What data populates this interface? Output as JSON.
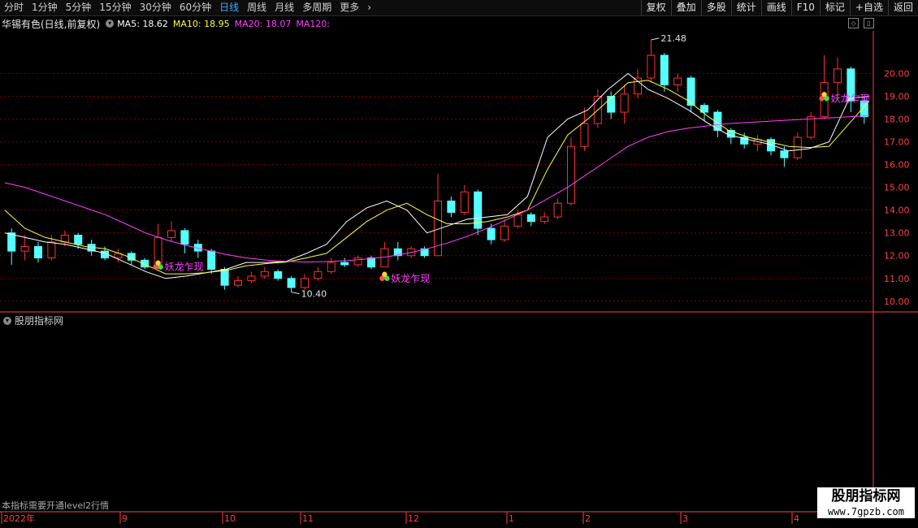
{
  "toolbar": {
    "periods": [
      "分时",
      "1分钟",
      "5分钟",
      "15分钟",
      "30分钟",
      "60分钟",
      "日线",
      "周线",
      "月线",
      "多周期",
      "更多"
    ],
    "active_period": "日线",
    "tools": [
      "复权",
      "叠加",
      "多股",
      "统计",
      "画线",
      "F10",
      "标记",
      "+自选",
      "返回"
    ]
  },
  "chart_header": {
    "title": "华锡有色(日线,前复权)",
    "ma5": "MA5: 18.62",
    "ma10": "MA10: 18.95",
    "ma20": "MA20: 18.07",
    "ma120": "MA120:"
  },
  "colors": {
    "up": "#ff3030",
    "down": "#54ffff",
    "ma5": "#ffffff",
    "ma10": "#ffff40",
    "ma120": "#ff40ff",
    "signal_text": "#ff40ff",
    "grid": "#7a0000",
    "axis_text": "#ff4040",
    "active_tab": "#4aa6ff"
  },
  "chart_data": {
    "type": "candlestick",
    "y_ticks": [
      "20.00",
      "19.00",
      "18.00",
      "17.00",
      "16.00",
      "15.00",
      "14.00",
      "13.00",
      "12.00",
      "11.00",
      "10.00"
    ],
    "ylim": [
      9.6,
      21.8
    ],
    "x_labels": [
      "2022年",
      "9",
      "10",
      "11",
      "12",
      "1",
      "2",
      "3",
      "4"
    ],
    "annotations": {
      "high": "21.48",
      "low": "10.40",
      "signals": [
        "妖龙乍现",
        "妖龙乍现",
        "妖龙乍现"
      ]
    },
    "series": [
      {
        "name": "MA5",
        "values": [
          13.0,
          12.8,
          12.6,
          12.5,
          12.3,
          12.1,
          11.7,
          11.3,
          11.0,
          11.1,
          11.25,
          11.4,
          11.7,
          11.7,
          11.75,
          12.1,
          12.5,
          13.5,
          14.1,
          14.4,
          14.0,
          13.0,
          13.3,
          13.6,
          13.7,
          13.8,
          14.6,
          17.2,
          18.0,
          18.4,
          19.3,
          20.0,
          19.3,
          18.9,
          18.4,
          17.8,
          17.3,
          17.1,
          16.9,
          16.6,
          16.7,
          17.0,
          18.9,
          19.0
        ]
      },
      {
        "name": "MA10",
        "values": [
          14.0,
          13.2,
          12.8,
          12.6,
          12.4,
          12.3,
          12.0,
          11.6,
          11.2,
          11.2,
          11.25,
          11.35,
          11.55,
          11.65,
          11.72,
          11.9,
          12.1,
          12.8,
          13.5,
          14.0,
          14.3,
          13.8,
          13.4,
          13.4,
          13.5,
          13.7,
          14.0,
          15.8,
          17.3,
          18.0,
          18.8,
          19.6,
          19.7,
          19.3,
          18.8,
          18.1,
          17.5,
          17.2,
          17.0,
          16.8,
          16.75,
          16.8,
          17.8,
          18.8
        ]
      },
      {
        "name": "MA120",
        "values": [
          15.2,
          15.0,
          14.7,
          14.4,
          14.1,
          13.8,
          13.4,
          13.0,
          12.7,
          12.45,
          12.25,
          12.05,
          11.9,
          11.8,
          11.75,
          11.72,
          11.74,
          11.78,
          11.85,
          11.95,
          12.1,
          12.3,
          12.55,
          12.85,
          13.2,
          13.6,
          14.0,
          14.5,
          15.0,
          15.6,
          16.2,
          16.8,
          17.2,
          17.45,
          17.6,
          17.7,
          17.8,
          17.85,
          17.9,
          17.95,
          18.0,
          18.05,
          18.1,
          18.15
        ]
      }
    ],
    "candles": [
      [
        13.0,
        12.2,
        13.2,
        11.6
      ],
      [
        12.2,
        12.4,
        12.9,
        11.8
      ],
      [
        12.4,
        11.9,
        12.6,
        11.7
      ],
      [
        11.9,
        12.6,
        12.9,
        11.8
      ],
      [
        12.6,
        12.9,
        13.1,
        12.4
      ],
      [
        12.9,
        12.5,
        13.0,
        12.3
      ],
      [
        12.5,
        12.2,
        12.7,
        12.0
      ],
      [
        12.2,
        11.9,
        12.4,
        11.8
      ],
      [
        11.9,
        12.1,
        12.3,
        11.7
      ],
      [
        12.1,
        11.8,
        12.2,
        11.6
      ],
      [
        11.8,
        11.5,
        11.9,
        11.4
      ],
      [
        11.5,
        12.8,
        13.4,
        11.4
      ],
      [
        12.8,
        13.1,
        13.5,
        12.6
      ],
      [
        13.1,
        12.5,
        13.2,
        12.1
      ],
      [
        12.5,
        12.2,
        12.7,
        11.9
      ],
      [
        12.2,
        11.4,
        12.3,
        11.2
      ],
      [
        11.4,
        10.7,
        11.5,
        10.5
      ],
      [
        10.7,
        10.9,
        11.1,
        10.6
      ],
      [
        10.9,
        11.1,
        11.3,
        10.8
      ],
      [
        11.1,
        11.3,
        11.5,
        11.0
      ],
      [
        11.3,
        11.0,
        11.4,
        10.9
      ],
      [
        11.0,
        10.6,
        11.1,
        10.4
      ],
      [
        10.6,
        11.0,
        11.2,
        10.5
      ],
      [
        11.0,
        11.3,
        11.5,
        10.9
      ],
      [
        11.3,
        11.7,
        11.9,
        11.2
      ],
      [
        11.7,
        11.6,
        11.9,
        11.5
      ],
      [
        11.6,
        11.9,
        12.0,
        11.5
      ],
      [
        11.9,
        11.5,
        12.0,
        11.4
      ],
      [
        11.5,
        12.3,
        12.6,
        11.5
      ],
      [
        12.3,
        12.0,
        12.6,
        11.8
      ],
      [
        12.0,
        12.3,
        12.4,
        11.9
      ],
      [
        12.3,
        12.0,
        12.4,
        11.9
      ],
      [
        12.0,
        14.4,
        15.6,
        12.0
      ],
      [
        14.4,
        13.9,
        14.6,
        13.7
      ],
      [
        13.9,
        14.8,
        15.1,
        13.8
      ],
      [
        14.8,
        13.2,
        14.9,
        12.9
      ],
      [
        13.2,
        12.7,
        13.4,
        12.5
      ],
      [
        12.7,
        13.3,
        13.6,
        12.6
      ],
      [
        13.3,
        13.8,
        14.0,
        13.2
      ],
      [
        13.8,
        13.5,
        13.9,
        13.3
      ],
      [
        13.5,
        13.7,
        13.9,
        13.4
      ],
      [
        13.7,
        14.3,
        14.5,
        13.6
      ],
      [
        14.3,
        16.8,
        17.2,
        14.2
      ],
      [
        16.8,
        17.8,
        18.5,
        16.6
      ],
      [
        17.8,
        19.0,
        19.3,
        17.6
      ],
      [
        19.0,
        18.3,
        19.2,
        18.0
      ],
      [
        18.3,
        19.1,
        19.5,
        17.8
      ],
      [
        19.1,
        19.8,
        20.2,
        18.9
      ],
      [
        19.8,
        20.8,
        21.48,
        19.6
      ],
      [
        20.8,
        19.5,
        20.9,
        19.2
      ],
      [
        19.5,
        19.8,
        20.0,
        19.2
      ],
      [
        19.8,
        18.6,
        19.9,
        18.3
      ],
      [
        18.6,
        18.3,
        18.7,
        17.9
      ],
      [
        18.3,
        17.5,
        18.4,
        17.2
      ],
      [
        17.5,
        17.2,
        17.6,
        16.9
      ],
      [
        17.2,
        16.9,
        17.4,
        16.7
      ],
      [
        16.9,
        17.1,
        17.3,
        16.6
      ],
      [
        17.1,
        16.6,
        17.2,
        16.4
      ],
      [
        16.6,
        16.3,
        16.8,
        15.9
      ],
      [
        16.3,
        17.2,
        17.4,
        16.2
      ],
      [
        17.2,
        18.1,
        18.3,
        17.1
      ],
      [
        18.1,
        19.6,
        20.8,
        18.0
      ],
      [
        19.6,
        20.2,
        20.7,
        19.0
      ],
      [
        20.2,
        18.8,
        20.3,
        18.3
      ],
      [
        18.8,
        18.1,
        19.0,
        17.8
      ]
    ]
  },
  "subchart": {
    "title": "股朋指标网"
  },
  "footer_note": "本指标需要开通level2行情",
  "watermark": {
    "line1": "股朋指标网",
    "line2": "www.7gpzb.com"
  }
}
